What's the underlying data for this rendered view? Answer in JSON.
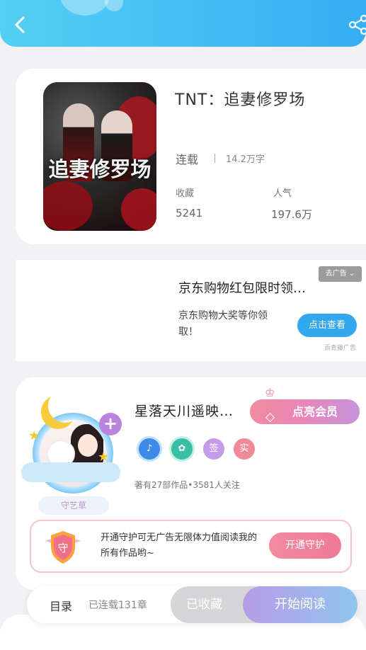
{
  "book": {
    "title": "TNT：追妻修罗场",
    "cover_text": "追妻修罗场",
    "status": "连载",
    "word_count": "14.2万字",
    "collect_label": "收藏",
    "collect_value": "5241",
    "popularity_label": "人气",
    "popularity_value": "197.6万"
  },
  "ad": {
    "tag": "去广告",
    "title": "京东购物红包限时领…",
    "description": "京东购物大奖等你领取！",
    "button_label": "点击查看",
    "source": "百青藤广告"
  },
  "author": {
    "name": "星落天川遥映…",
    "nameplate": "守艺草",
    "vip_button_label": "点亮会员",
    "badges": [
      "♪",
      "✿",
      "签",
      "实"
    ],
    "meta": "著有27部作品•3581人关注"
  },
  "guard": {
    "shield_label": "守",
    "text": "开通守护可无广告无限体力值阅读我的所有作品哟~",
    "button_label": "开通守护"
  },
  "bottom": {
    "catalog_label": "目录",
    "catalog_count": "已连载131章",
    "favorite_label": "已收藏",
    "read_label": "开始阅读"
  },
  "colors": {
    "header_gradient_start": "#55cff3",
    "header_gradient_end": "#35aef4",
    "ad_button": "#33a8ef",
    "vip_pink": "#f08ca0",
    "vip_purple": "#c594dc"
  },
  "icons": {
    "back": "chevron-left-icon",
    "share": "share-icon",
    "vip": "diamond-icon"
  }
}
